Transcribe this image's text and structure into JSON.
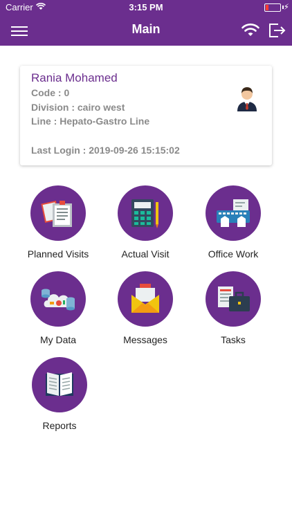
{
  "status_bar": {
    "carrier": "Carrier",
    "time": "3:15 PM"
  },
  "nav": {
    "title": "Main"
  },
  "profile": {
    "name": "Rania Mohamed",
    "code": "Code : 0",
    "division": "Division : cairo west",
    "line": "Line : Hepato-Gastro Line",
    "last_login": "Last Login : 2019-09-26 15:15:02"
  },
  "tiles": [
    {
      "label": "Planned Visits",
      "icon": "planned-visits-icon"
    },
    {
      "label": "Actual Visit",
      "icon": "calculator-icon"
    },
    {
      "label": "Office Work",
      "icon": "office-work-icon"
    },
    {
      "label": "My Data",
      "icon": "cloud-data-icon"
    },
    {
      "label": "Messages",
      "icon": "envelope-icon"
    },
    {
      "label": "Tasks",
      "icon": "tasks-briefcase-icon"
    },
    {
      "label": "Reports",
      "icon": "book-icon"
    }
  ],
  "colors": {
    "brand": "#6b2e8e",
    "muted_text": "#8a8a8a"
  }
}
